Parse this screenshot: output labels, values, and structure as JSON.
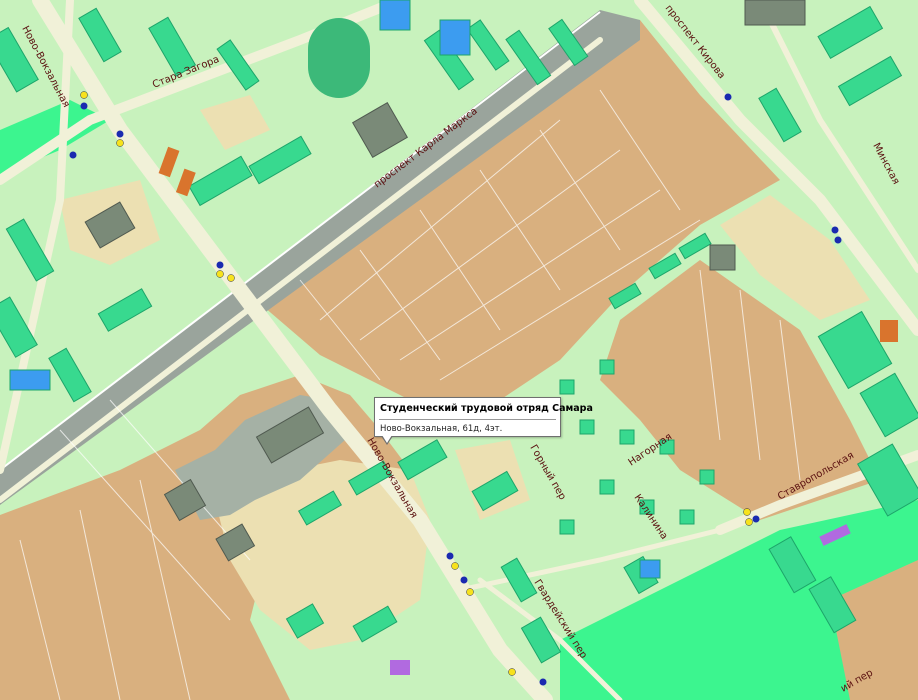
{
  "map": {
    "colors": {
      "park": "#c8f2bd",
      "private_sector": "#d9b07f",
      "industrial": "#a5b1a5",
      "plaza": "#ece0b2",
      "big_park": "#3cf58f",
      "building": "#38d98f",
      "building_dark": "#1da56a",
      "road": "#f1f1d8",
      "railway": "#9aa49c",
      "stop_blue": "#1a2ab0",
      "stop_yellow": "#f7e21d"
    },
    "streets": {
      "novo_vokzalnaya": "Ново-Вокзальная",
      "stara_zagora": "Стара Загора",
      "karla_marksa": "проспект Карла Маркса",
      "kirova": "проспект Кирова",
      "minskaya": "Минская",
      "stavropolskaya": "Ставропольская",
      "nagornaya": "Нагорная",
      "kalinina": "Калинина",
      "gvardeyskiy": "Гвардейский пер",
      "gornyy": "Горный пер",
      "novo_vokzalnaya_center": "Ново-Вокзальная",
      "bottom_right": "ий пер"
    }
  },
  "popup": {
    "title": "Студенческий трудовой отряд Самара",
    "address": "Ново-Вокзальная, 61д, 4эт."
  }
}
